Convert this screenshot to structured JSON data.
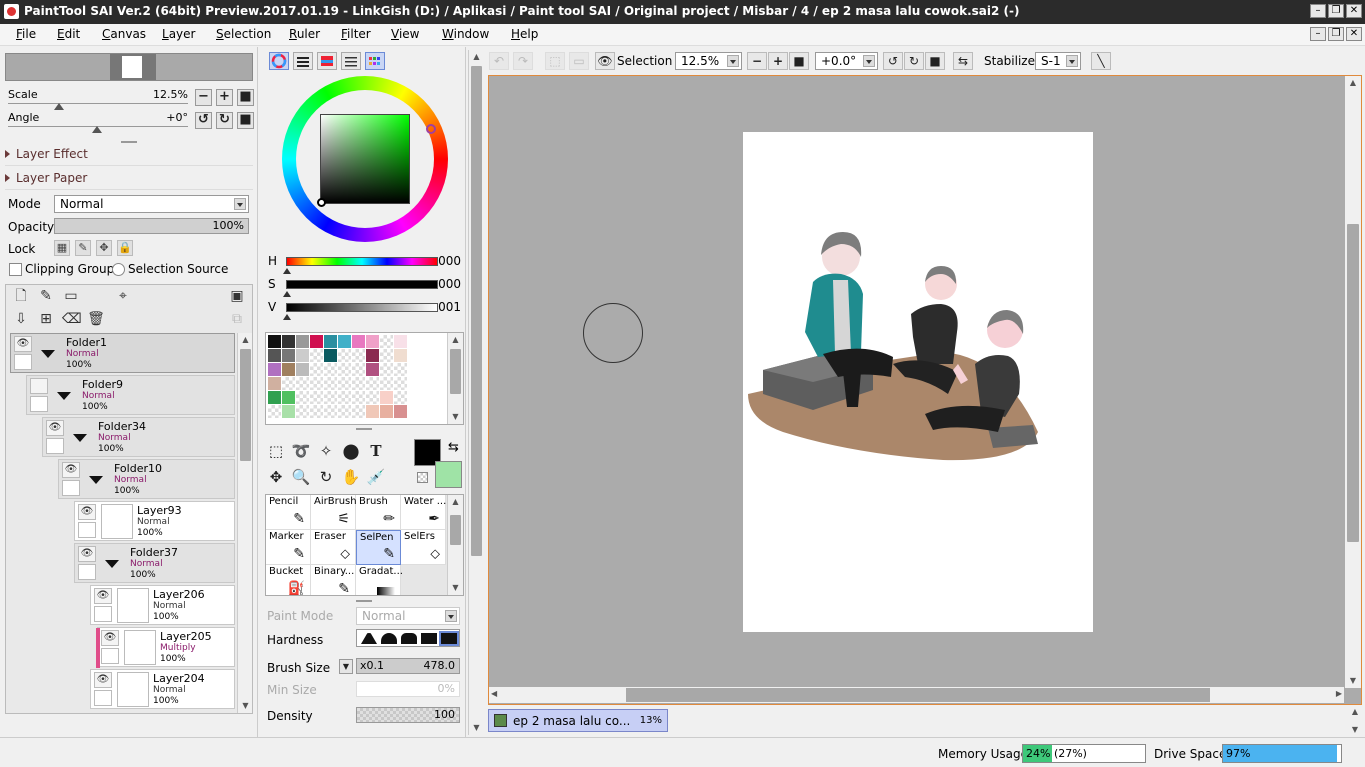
{
  "window": {
    "title": "PaintTool SAI Ver.2 (64bit) Preview.2017.01.19 - LinkGish (D:) / Aplikasi / Paint tool SAI / Original project / Misbar / 4 / ep 2 masa lalu cowok.sai2 (-)"
  },
  "menu": [
    "File",
    "Edit",
    "Canvas",
    "Layer",
    "Selection",
    "Ruler",
    "Filter",
    "View",
    "Window",
    "Help"
  ],
  "navigator": {
    "scale_label": "Scale",
    "scale_value": "12.5%",
    "angle_label": "Angle",
    "angle_value": "+0°"
  },
  "sections": {
    "layer_effect": "Layer Effect",
    "layer_paper": "Layer Paper"
  },
  "layer_props": {
    "mode_label": "Mode",
    "mode_value": "Normal",
    "opacity_label": "Opacity",
    "opacity_value": "100%",
    "lock_label": "Lock",
    "clipping_label": "Clipping Group",
    "selection_source_label": "Selection Source"
  },
  "layers": [
    {
      "name": "Folder1",
      "mode": "Normal",
      "opacity": "100%",
      "folder": true
    },
    {
      "name": "Folder9",
      "mode": "Normal",
      "opacity": "100%",
      "folder": true
    },
    {
      "name": "Folder34",
      "mode": "Normal",
      "opacity": "100%",
      "folder": true
    },
    {
      "name": "Folder10",
      "mode": "Normal",
      "opacity": "100%",
      "folder": true
    },
    {
      "name": "Layer93",
      "mode": "Normal",
      "opacity": "100%",
      "folder": false
    },
    {
      "name": "Folder37",
      "mode": "Normal",
      "opacity": "100%",
      "folder": true
    },
    {
      "name": "Layer206",
      "mode": "Normal",
      "opacity": "100%",
      "folder": false
    },
    {
      "name": "Layer205",
      "mode": "Multiply",
      "opacity": "100%",
      "folder": false
    },
    {
      "name": "Layer204",
      "mode": "Normal",
      "opacity": "100%",
      "folder": false
    }
  ],
  "color": {
    "h_label": "H",
    "h_value": "000",
    "s_label": "S",
    "s_value": "000",
    "v_label": "V",
    "v_value": "001",
    "primary": "#000000",
    "secondary": "#9fe3a6"
  },
  "swatch_colors": [
    "#111111",
    "#333333",
    "#999999",
    "#d01050",
    "#2a8fa0",
    "#40b0c8",
    "#e878c0",
    "#f0a0c8",
    "#ffffff",
    "#f8e0e8",
    "#555555",
    "#777777",
    "#cccccc",
    "#ffffff",
    "#0a5a60",
    "#ffffff",
    "#ffffff",
    "#8a2a50",
    "#ffffff",
    "#f0ddd0",
    "#b070c0",
    "#a08060",
    "#bbbbbb",
    "#ffffff",
    "#ffffff",
    "#ffffff",
    "#ffffff",
    "#b05080",
    "#ffffff",
    "#ffffff",
    "#d0b0a0",
    "#ffffff",
    "#ffffff",
    "#ffffff",
    "#ffffff",
    "#ffffff",
    "#ffffff",
    "#ffffff",
    "#ffffff",
    "#ffffff",
    "#30a050",
    "#50c060",
    "#ffffff",
    "#ffffff",
    "#ffffff",
    "#ffffff",
    "#ffffff",
    "#ffffff",
    "#f8d0c8",
    "#ffffff",
    "#ffffff",
    "#a8e0a8",
    "#ffffff",
    "#ffffff",
    "#ffffff",
    "#ffffff",
    "#ffffff",
    "#f0c8b8",
    "#e8b0a0",
    "#d89090"
  ],
  "brushes": [
    {
      "name": "Pencil",
      "icon": "✎"
    },
    {
      "name": "AirBrush",
      "icon": "⚟"
    },
    {
      "name": "Brush",
      "icon": "✏"
    },
    {
      "name": "Water ...",
      "icon": "✒"
    },
    {
      "name": "Marker",
      "icon": "✎"
    },
    {
      "name": "Eraser",
      "icon": "⬦"
    },
    {
      "name": "SelPen",
      "icon": "✎"
    },
    {
      "name": "SelErs",
      "icon": "⬦"
    },
    {
      "name": "Bucket",
      "icon": "⛽"
    },
    {
      "name": "Binary...",
      "icon": "✎"
    },
    {
      "name": "Gradat...",
      "icon": "▬"
    }
  ],
  "brush_props": {
    "paint_mode_label": "Paint Mode",
    "paint_mode_value": "Normal",
    "hardness_label": "Hardness",
    "brush_size_label": "Brush Size",
    "brush_size_mult": "x0.1",
    "brush_size_value": "478.0",
    "min_size_label": "Min Size",
    "min_size_value": "0%",
    "density_label": "Density",
    "density_value": "100"
  },
  "toolbar": {
    "selection_label": "Selection",
    "zoom_value": "12.5%",
    "rotation_value": "+0.0°",
    "stabilizer_label": "Stabilizer",
    "stabilizer_value": "S-1"
  },
  "document": {
    "tab_name": "ep 2 masa lalu co...",
    "tab_zoom": "13%"
  },
  "status": {
    "memory_label": "Memory Usage",
    "memory_value": "24% (27%)",
    "memory_fraction": 0.24,
    "drive_label": "Drive Space",
    "drive_value": "97%",
    "drive_fraction": 0.97
  }
}
